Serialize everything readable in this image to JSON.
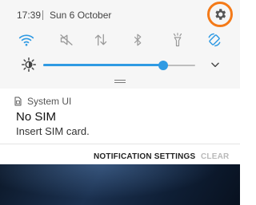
{
  "status_bar": {
    "time": "17:39",
    "date": "Sun 6 October"
  },
  "quick_settings": {
    "active_color": "#2f9ae3",
    "inactive_color": "#9a9a9a",
    "toggles": [
      {
        "name": "wifi",
        "state": "on"
      },
      {
        "name": "sound",
        "state": "muted"
      },
      {
        "name": "mobile-data",
        "state": "off"
      },
      {
        "name": "bluetooth",
        "state": "off"
      },
      {
        "name": "flashlight",
        "state": "off"
      },
      {
        "name": "auto-rotate",
        "state": "on"
      }
    ]
  },
  "brightness": {
    "level": 0.79
  },
  "notification": {
    "app_name": "System UI",
    "title": "No SIM",
    "text": "Insert SIM card.",
    "actions": {
      "settings": "NOTIFICATION SETTINGS",
      "clear": "CLEAR"
    }
  },
  "highlight_color": "#f47a18"
}
